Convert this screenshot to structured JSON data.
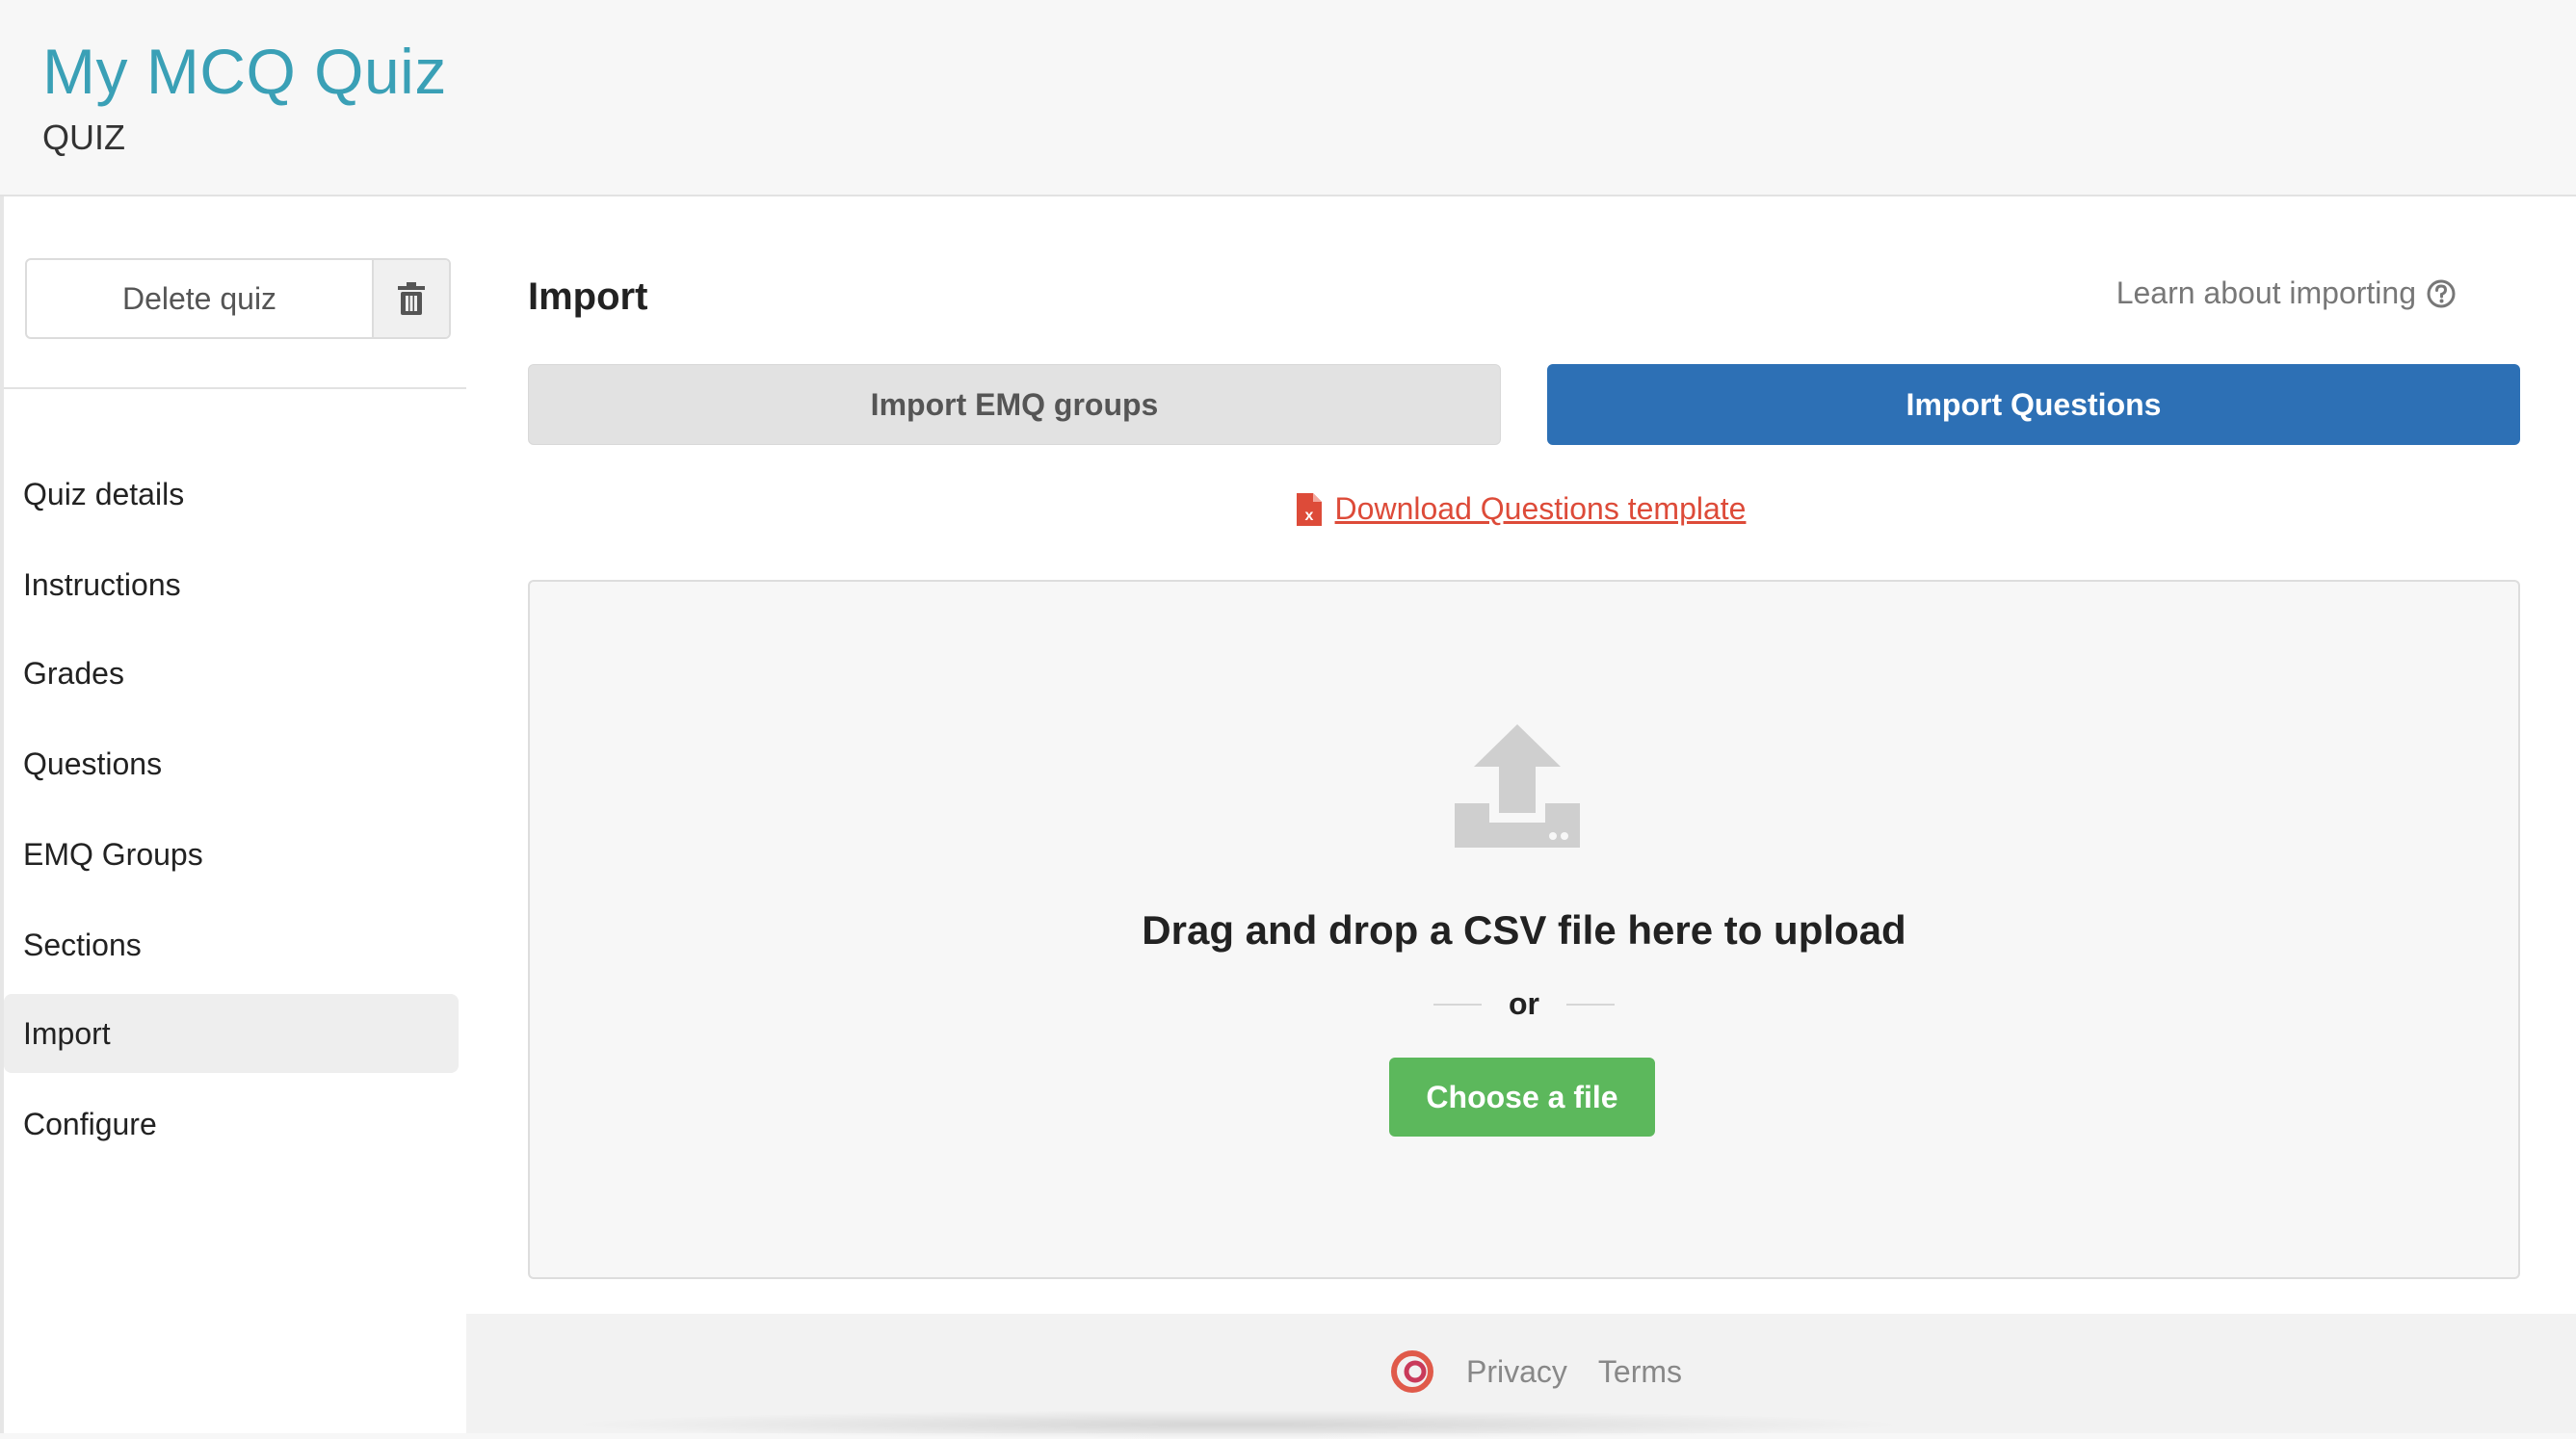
{
  "header": {
    "title": "My MCQ Quiz",
    "subtitle": "QUIZ"
  },
  "sidebar": {
    "delete_label": "Delete quiz",
    "items": [
      {
        "label": "Quiz details",
        "active": false
      },
      {
        "label": "Instructions",
        "active": false
      },
      {
        "label": "Grades",
        "active": false
      },
      {
        "label": "Questions",
        "active": false
      },
      {
        "label": "EMQ Groups",
        "active": false
      },
      {
        "label": "Sections",
        "active": false
      },
      {
        "label": "Import",
        "active": true
      },
      {
        "label": "Configure",
        "active": false
      }
    ]
  },
  "main": {
    "title": "Import",
    "learn_link": "Learn about importing",
    "tabs": {
      "emq": "Import EMQ groups",
      "questions": "Import Questions"
    },
    "download_link": "Download Questions template",
    "dropzone": {
      "text": "Drag and drop a CSV file here to upload",
      "or": "or",
      "button": "Choose a file"
    }
  },
  "footer": {
    "privacy": "Privacy",
    "terms": "Terms"
  },
  "colors": {
    "title": "#3aa0b6",
    "primary": "#2d70b5",
    "success": "#5cb85c",
    "danger": "#dd4b39"
  },
  "icons": [
    "trash-icon",
    "help-circle-icon",
    "excel-file-icon",
    "upload-icon",
    "logo-icon"
  ]
}
